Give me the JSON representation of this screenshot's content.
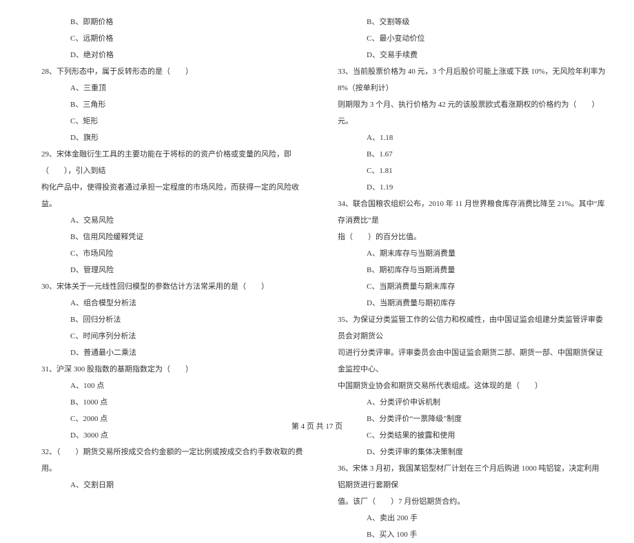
{
  "left": {
    "opts_top": [
      "B、即期价格",
      "C、远期价格",
      "D、绝对价格"
    ],
    "q28": "28、下列形态中，属于反转形态的是（　　）",
    "q28_opts": [
      "A、三重顶",
      "B、三角形",
      "C、矩形",
      "D、旗形"
    ],
    "q29_l1": "29、宋体金融衍生工具的主要功能在于将标的的资产价格或变量的风险，即（　　），引入到结",
    "q29_l2": "构化产品中，使得投资者通过承担一定程度的市场风险，而获得一定的风险收益。",
    "q29_opts": [
      "A、交易风险",
      "B、信用风险缓释凭证",
      "C、市场风险",
      "D、管理风险"
    ],
    "q30": "30、宋体关于一元线性回归模型的参数估计方法常采用的是（　　）",
    "q30_opts": [
      "A、组合模型分析法",
      "B、回归分析法",
      "C、时间序列分析法",
      "D、普通最小二乘法"
    ],
    "q31": "31、沪深 300 股指数的基期指数定为（　　）",
    "q31_opts": [
      "A、100 点",
      "B、1000 点",
      "C、2000 点",
      "D、3000 点"
    ],
    "q32_l1": "32、（　　）期货交易所按成交合约金额的一定比例或按成交合约手数收取的费用。",
    "q32_opt1": "A、交割日期"
  },
  "right": {
    "opts_top": [
      "B、交割等级",
      "C、最小变动价位",
      "D、交易手续费"
    ],
    "q33_l1": "33、当前股票价格为 40 元，3 个月后股价可能上涨或下跌 10%，无风险年利率为 8%（按单利计）",
    "q33_l2": "则期限为 3 个月、执行价格为 42 元的该股票欧式看涨期权的价格约为（　　）元。",
    "q33_opts": [
      "A、1.18",
      "B、1.67",
      "C、1.81",
      "D、1.19"
    ],
    "q34_l1": "34、联合国粮农组织公布，2010 年 11 月世界粮食库存消费比降至 21%。其中“库存消费比”是",
    "q34_l2": "指（　　）的百分比值。",
    "q34_opts": [
      "A、期末库存与当期消费量",
      "B、期初库存与当期消费量",
      "C、当期消费量与期末库存",
      "D、当期消费量与期初库存"
    ],
    "q35_l1": "35、为保证分类监管工作的公信力和权威性，由中国证监会组建分类监管评审委员会对期货公",
    "q35_l2": "司进行分类评审。评审委员会由中国证监会期货二部、期货一部、中国期货保证金监控中心、",
    "q35_l3": "中国期货业协会和期货交易所代表组成。这体现的是（　　）",
    "q35_opts": [
      "A、分类评价申诉机制",
      "B、分类评价“一票降级”制度",
      "C、分类结果的披露和使用",
      "D、分类评审的集体决策制度"
    ],
    "q36_l1": "36、宋体 3 月初，我国某铝型材厂计划在三个月后购进 1000 吨铝锭，决定利用铝期货进行套期保",
    "q36_l2": "值。该厂（　　）7 月份铝期货合约。",
    "q36_opts": [
      "A、卖出 200 手",
      "B、买入 100 手"
    ]
  },
  "footer": "第 4 页  共 17 页"
}
